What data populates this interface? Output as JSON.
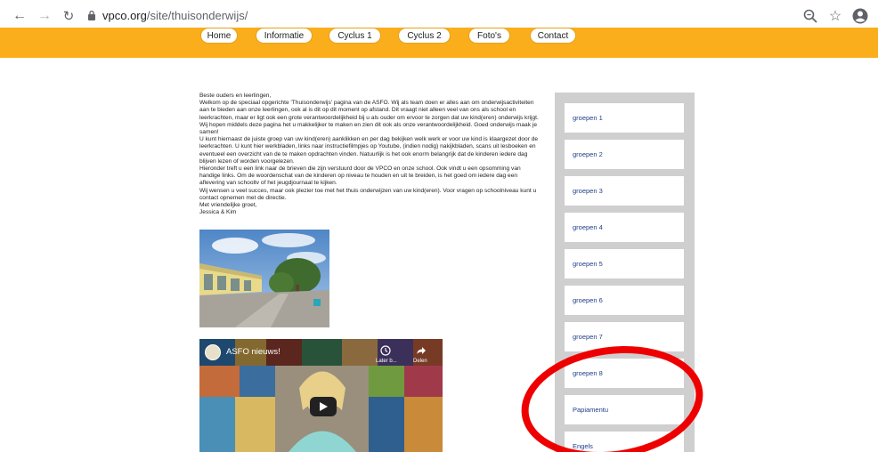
{
  "browser": {
    "url_domain": "vpco.org",
    "url_path": "/site/thuisonderwijs/"
  },
  "colors": {
    "header_orange": "#fbae1c",
    "sidebar_gray": "#cfcfcf",
    "link_blue": "#1f3c88",
    "highlight_red": "#ee0000"
  },
  "menu": [
    {
      "label": "Home"
    },
    {
      "label": "Informatie"
    },
    {
      "label": "Cyclus 1"
    },
    {
      "label": "Cyclus 2"
    },
    {
      "label": "Foto's"
    },
    {
      "label": "Contact"
    }
  ],
  "content": {
    "greeting": "Beste ouders en leerlingen,",
    "para1": "Welkom op de speciaal opgerichte 'Thuisonderwijs' pagina van de ASFO. Wij als team doen er alles aan om onderwijsactiviteiten aan te bieden aan onze leerlingen, ook al is dit op dit moment op afstand. Dit vraagt niet alleen veel van ons als school en leerkrachten, maar er ligt ook een grote verantwoordelijkheid bij u als ouder om ervoor te zorgen dat uw kind(eren) onderwijs krijgt. Wij hopen middels deze pagina het u makkelijker te maken en zien dit ook als onze verantwoordelijkheid. Goed onderwijs maak je samen!",
    "para2": "U kunt hiernaast de juiste groep van uw kind(eren) aanklikken en per dag bekijken welk werk er voor uw kind is klaargezet door de leerkrachten. U kunt hier werkbladen, links naar instructiefilmpjes op Youtube, (indien nodig) nakijkbladen, scans uit lesboeken en eventueel een overzicht van de te maken opdrachten vinden. Natuurlijk is het ook enorm belangrijk dat de kinderen iedere dag blijven lezen of worden voorgelezen.",
    "para3": "Hieronder treft u een link naar de brieven die zijn verstuurd door de VPCO en onze school. Ook vindt u een opsomming van handige links. Om de woordenschat van de kinderen op niveau te houden en uit te breiden, is het goed om iedere dag een aflevering van schooltv of het jeugdjournaal te kijken.",
    "para4": "Wij wensen u veel succes, maar ook plezier toe met het thuis onderwijzen van uw kind(eren). Voor vragen op schoolniveau kunt u contact opnemen met de directie.",
    "closing": "Met vriendelijke groet,",
    "signature": "Jessica & Kim"
  },
  "video": {
    "title": "ASFO nieuws!",
    "later_label": "Later b...",
    "share_label": "Delen"
  },
  "sidebar": [
    {
      "label": "groepen 1"
    },
    {
      "label": "groepen 2"
    },
    {
      "label": "groepen 3"
    },
    {
      "label": "groepen 4"
    },
    {
      "label": "groepen 5"
    },
    {
      "label": "groepen 6"
    },
    {
      "label": "groepen 7"
    },
    {
      "label": "groepen 8"
    },
    {
      "label": "Papiamentu"
    },
    {
      "label": "Engels"
    }
  ]
}
